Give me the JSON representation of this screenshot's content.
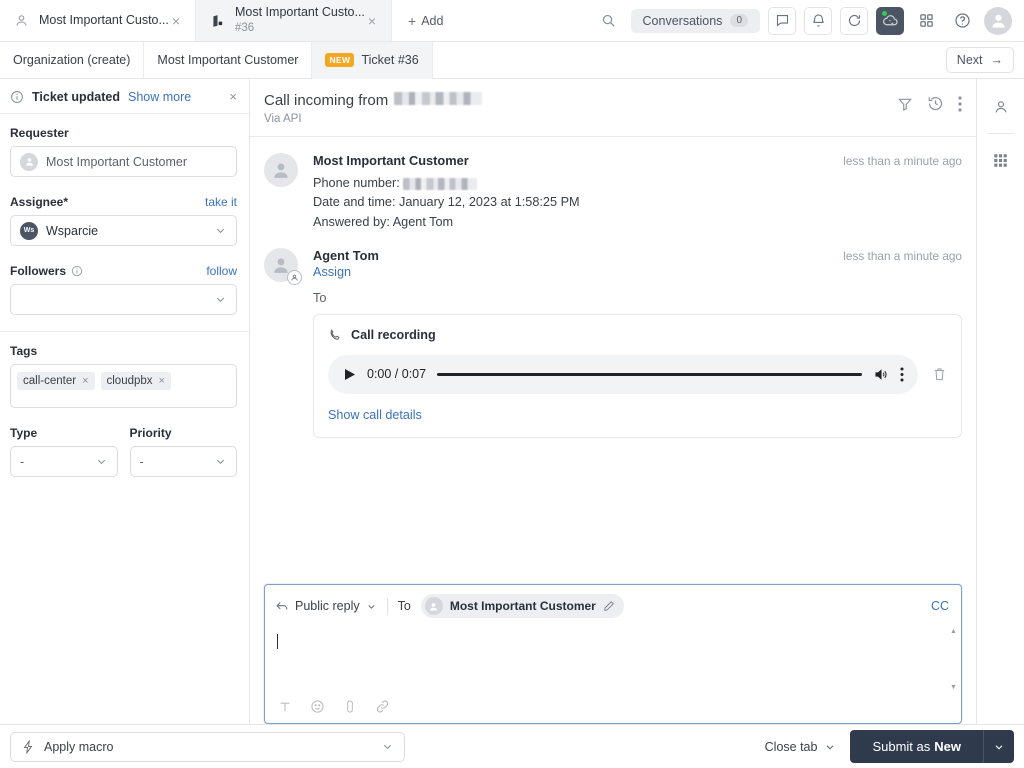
{
  "topbar": {
    "tabs": [
      {
        "title": "Most Important Custo...",
        "subtitle": "",
        "icon": "user-icon",
        "active": false,
        "close": "×"
      },
      {
        "title": "Most Important Custo...",
        "subtitle": "#36",
        "icon": "ticket-icon",
        "active": true,
        "close": "×"
      }
    ],
    "add_label": "Add",
    "add_plus": "+",
    "search_icon": "search-icon",
    "conversations_label": "Conversations",
    "conversations_count": "0",
    "icons": [
      "chat-icon",
      "bell-icon",
      "refresh-icon",
      "cloud-phone-icon",
      "apps-grid-icon",
      "help-icon",
      "avatar"
    ]
  },
  "breadcrumb": {
    "items": [
      {
        "label": "Organization (create)",
        "badge": "",
        "active": false
      },
      {
        "label": "Most Important Customer",
        "badge": "",
        "active": false
      },
      {
        "label": "Ticket #36",
        "badge": "NEW",
        "active": true
      }
    ],
    "next_label": "Next",
    "next_arrow": "→"
  },
  "sidebar": {
    "notice": {
      "title": "Ticket updated",
      "link": "Show more",
      "close": "×",
      "icon": "info-icon"
    },
    "requester": {
      "label": "Requester",
      "value": "Most Important Customer"
    },
    "assignee": {
      "label": "Assignee*",
      "action": "take it",
      "value": "Wsparcie",
      "avatar_initials": "Ws"
    },
    "followers": {
      "label": "Followers",
      "action": "follow",
      "value": "",
      "info_icon": "info-icon"
    },
    "tags": {
      "label": "Tags",
      "items": [
        {
          "name": "call-center",
          "remove": "×"
        },
        {
          "name": "cloudpbx",
          "remove": "×"
        }
      ]
    },
    "type": {
      "label": "Type",
      "value": "-"
    },
    "priority": {
      "label": "Priority",
      "value": "-"
    }
  },
  "main": {
    "header": {
      "title_prefix": "Call incoming from",
      "title_redacted": true,
      "subtitle": "Via API",
      "icons": [
        "filter-icon",
        "history-icon",
        "more-vertical-icon"
      ]
    },
    "messages": [
      {
        "author": "Most Important Customer",
        "time": "less than a minute ago",
        "lines": [
          "Phone number:",
          "Date and time: January 12, 2023 at 1:58:25 PM",
          "Answered by: Agent Tom"
        ],
        "has_redacted_phone": true
      },
      {
        "author": "Agent Tom",
        "time": "less than a minute ago",
        "link": "Assign",
        "to_label": "To"
      }
    ],
    "recording": {
      "title": "Call recording",
      "icon": "phone-icon",
      "play_icon": "play-icon",
      "time": "0:00 / 0:07",
      "volume_icon": "volume-icon",
      "menu_icon": "more-vertical-icon",
      "delete_icon": "trash-icon",
      "details_link": "Show call details"
    },
    "composer": {
      "reply_type": "Public reply",
      "to_label": "To",
      "to_recipient": "Most Important Customer",
      "edit_icon": "pencil-icon",
      "cc_label": "CC",
      "body_value": "",
      "tools": [
        "text-format-icon",
        "emoji-icon",
        "attachment-icon",
        "link-icon"
      ]
    }
  },
  "rail": {
    "items": [
      "customer-profile-icon",
      "apps-grid-icon"
    ]
  },
  "bottombar": {
    "macro_label": "Apply macro",
    "macro_icon": "lightning-icon",
    "close_tab_label": "Close tab",
    "submit_prefix": "Submit as ",
    "submit_state": "New"
  },
  "colors": {
    "accent_link": "#3b73b9",
    "badge_new": "#f5a623",
    "submit_bg": "#2f3b4c",
    "composer_border": "#7d9fc8",
    "online_dot": "#35c759"
  }
}
